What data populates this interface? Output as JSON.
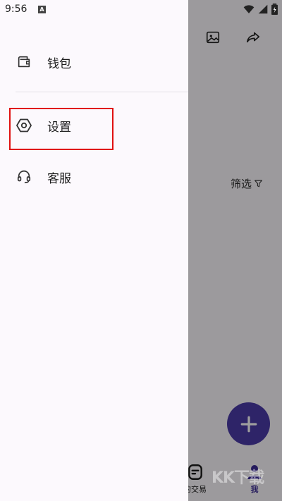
{
  "status_bar": {
    "time": "9:56",
    "badge": "A"
  },
  "background_app": {
    "filter_label": "筛选",
    "bottom_nav": [
      {
        "label": "的交易",
        "icon": "trade-icon",
        "active": false
      },
      {
        "label": "我",
        "icon": "profile-icon",
        "active": true
      }
    ],
    "watermark": "KK下载"
  },
  "drawer": {
    "items": [
      {
        "label": "钱包",
        "icon": "wallet-icon"
      },
      {
        "label": "设置",
        "icon": "settings-icon"
      },
      {
        "label": "客服",
        "icon": "headset-icon"
      }
    ]
  },
  "colors": {
    "accent": "#4b3aa8",
    "highlight": "#e01010",
    "drawer_bg": "#fcf9fd"
  }
}
